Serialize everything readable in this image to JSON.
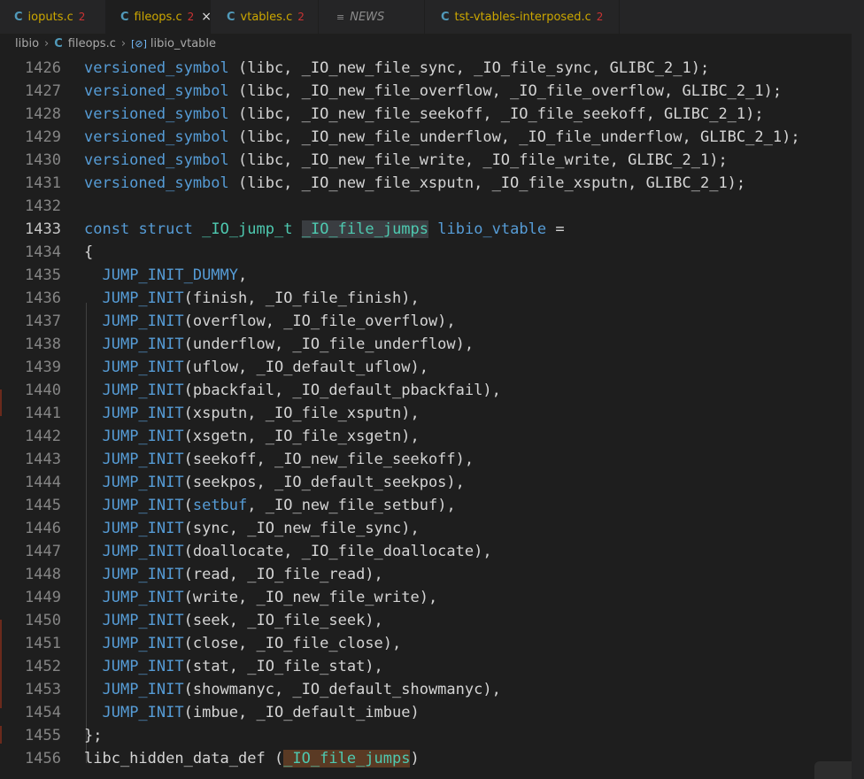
{
  "tabs": [
    {
      "label": "ioputs.c",
      "count": "2",
      "icon": "c-file-icon",
      "active": false
    },
    {
      "label": "fileops.c",
      "count": "2",
      "icon": "c-file-icon",
      "active": true
    },
    {
      "label": "vtables.c",
      "count": "2",
      "icon": "c-file-icon",
      "active": false
    },
    {
      "label": "NEWS",
      "count": "",
      "icon": "list-icon",
      "active": false
    },
    {
      "label": "tst-vtables-interposed.c",
      "count": "2",
      "icon": "c-file-icon",
      "active": false
    }
  ],
  "icons": {
    "c_file": "C",
    "close": "×",
    "news": "≡",
    "variable": "[⊘]"
  },
  "breadcrumb": {
    "folder": "libio",
    "file": "fileops.c",
    "symbol": "libio_vtable"
  },
  "colors": {
    "keyword": "#569cd6",
    "type": "#4ec9b0",
    "macro": "#569cd6",
    "plain": "#d4d4d4",
    "highlight_read": "#3a3d41",
    "highlight_write": "#5a3a24"
  },
  "lines": [
    {
      "num": "1426",
      "parts": [
        {
          "t": "versioned_symbol",
          "c": "k"
        },
        {
          "t": " (libc, _IO_new_file_sync, _IO_file_sync, GLIBC_2_1);",
          "c": "p"
        }
      ]
    },
    {
      "num": "1427",
      "parts": [
        {
          "t": "versioned_symbol",
          "c": "k"
        },
        {
          "t": " (libc, _IO_new_file_overflow, _IO_file_overflow, GLIBC_2_1);",
          "c": "p"
        }
      ]
    },
    {
      "num": "1428",
      "parts": [
        {
          "t": "versioned_symbol",
          "c": "k"
        },
        {
          "t": " (libc, _IO_new_file_seekoff, _IO_file_seekoff, GLIBC_2_1);",
          "c": "p"
        }
      ]
    },
    {
      "num": "1429",
      "parts": [
        {
          "t": "versioned_symbol",
          "c": "k"
        },
        {
          "t": " (libc, _IO_new_file_underflow, _IO_file_underflow, GLIBC_2_1);",
          "c": "p"
        }
      ]
    },
    {
      "num": "1430",
      "parts": [
        {
          "t": "versioned_symbol",
          "c": "k"
        },
        {
          "t": " (libc, _IO_new_file_write, _IO_file_write, GLIBC_2_1);",
          "c": "p"
        }
      ]
    },
    {
      "num": "1431",
      "parts": [
        {
          "t": "versioned_symbol",
          "c": "k"
        },
        {
          "t": " (libc, _IO_new_file_xsputn, _IO_file_xsputn, GLIBC_2_1);",
          "c": "p"
        }
      ]
    },
    {
      "num": "1432",
      "parts": []
    },
    {
      "num": "1433",
      "current": true,
      "parts": [
        {
          "t": "const",
          "c": "k"
        },
        {
          "t": " ",
          "c": "p"
        },
        {
          "t": "struct",
          "c": "k"
        },
        {
          "t": " ",
          "c": "p"
        },
        {
          "t": "_IO_jump_t",
          "c": "t"
        },
        {
          "t": " ",
          "c": "p"
        },
        {
          "t": "_IO_file_jumps",
          "c": "hl"
        },
        {
          "t": " ",
          "c": "p"
        },
        {
          "t": "libio_vtable",
          "c": "k"
        },
        {
          "t": " =",
          "c": "p"
        }
      ]
    },
    {
      "num": "1434",
      "parts": [
        {
          "t": "{",
          "c": "p"
        }
      ]
    },
    {
      "num": "1435",
      "parts": [
        {
          "t": "  ",
          "c": "p"
        },
        {
          "t": "JUMP_INIT_DUMMY",
          "c": "k"
        },
        {
          "t": ",",
          "c": "p"
        }
      ]
    },
    {
      "num": "1436",
      "parts": [
        {
          "t": "  ",
          "c": "p"
        },
        {
          "t": "JUMP_INIT",
          "c": "k"
        },
        {
          "t": "(finish, _IO_file_finish),",
          "c": "p"
        }
      ]
    },
    {
      "num": "1437",
      "parts": [
        {
          "t": "  ",
          "c": "p"
        },
        {
          "t": "JUMP_INIT",
          "c": "k"
        },
        {
          "t": "(overflow, _IO_file_overflow),",
          "c": "p"
        }
      ]
    },
    {
      "num": "1438",
      "parts": [
        {
          "t": "  ",
          "c": "p"
        },
        {
          "t": "JUMP_INIT",
          "c": "k"
        },
        {
          "t": "(underflow, _IO_file_underflow),",
          "c": "p"
        }
      ]
    },
    {
      "num": "1439",
      "parts": [
        {
          "t": "  ",
          "c": "p"
        },
        {
          "t": "JUMP_INIT",
          "c": "k"
        },
        {
          "t": "(uflow, _IO_default_uflow),",
          "c": "p"
        }
      ]
    },
    {
      "num": "1440",
      "parts": [
        {
          "t": "  ",
          "c": "p"
        },
        {
          "t": "JUMP_INIT",
          "c": "k"
        },
        {
          "t": "(pbackfail, _IO_default_pbackfail),",
          "c": "p"
        }
      ]
    },
    {
      "num": "1441",
      "parts": [
        {
          "t": "  ",
          "c": "p"
        },
        {
          "t": "JUMP_INIT",
          "c": "k"
        },
        {
          "t": "(xsputn, _IO_file_xsputn),",
          "c": "p"
        }
      ]
    },
    {
      "num": "1442",
      "parts": [
        {
          "t": "  ",
          "c": "p"
        },
        {
          "t": "JUMP_INIT",
          "c": "k"
        },
        {
          "t": "(xsgetn, _IO_file_xsgetn),",
          "c": "p"
        }
      ]
    },
    {
      "num": "1443",
      "parts": [
        {
          "t": "  ",
          "c": "p"
        },
        {
          "t": "JUMP_INIT",
          "c": "k"
        },
        {
          "t": "(seekoff, _IO_new_file_seekoff),",
          "c": "p"
        }
      ]
    },
    {
      "num": "1444",
      "parts": [
        {
          "t": "  ",
          "c": "p"
        },
        {
          "t": "JUMP_INIT",
          "c": "k"
        },
        {
          "t": "(seekpos, _IO_default_seekpos),",
          "c": "p"
        }
      ]
    },
    {
      "num": "1445",
      "parts": [
        {
          "t": "  ",
          "c": "p"
        },
        {
          "t": "JUMP_INIT",
          "c": "k"
        },
        {
          "t": "(",
          "c": "p"
        },
        {
          "t": "setbuf",
          "c": "k"
        },
        {
          "t": ", _IO_new_file_setbuf),",
          "c": "p"
        }
      ]
    },
    {
      "num": "1446",
      "parts": [
        {
          "t": "  ",
          "c": "p"
        },
        {
          "t": "JUMP_INIT",
          "c": "k"
        },
        {
          "t": "(sync, _IO_new_file_sync),",
          "c": "p"
        }
      ]
    },
    {
      "num": "1447",
      "parts": [
        {
          "t": "  ",
          "c": "p"
        },
        {
          "t": "JUMP_INIT",
          "c": "k"
        },
        {
          "t": "(doallocate, _IO_file_doallocate),",
          "c": "p"
        }
      ]
    },
    {
      "num": "1448",
      "parts": [
        {
          "t": "  ",
          "c": "p"
        },
        {
          "t": "JUMP_INIT",
          "c": "k"
        },
        {
          "t": "(read, _IO_file_read),",
          "c": "p"
        }
      ]
    },
    {
      "num": "1449",
      "parts": [
        {
          "t": "  ",
          "c": "p"
        },
        {
          "t": "JUMP_INIT",
          "c": "k"
        },
        {
          "t": "(write, _IO_new_file_write),",
          "c": "p"
        }
      ]
    },
    {
      "num": "1450",
      "parts": [
        {
          "t": "  ",
          "c": "p"
        },
        {
          "t": "JUMP_INIT",
          "c": "k"
        },
        {
          "t": "(seek, _IO_file_seek),",
          "c": "p"
        }
      ]
    },
    {
      "num": "1451",
      "parts": [
        {
          "t": "  ",
          "c": "p"
        },
        {
          "t": "JUMP_INIT",
          "c": "k"
        },
        {
          "t": "(close, _IO_file_close),",
          "c": "p"
        }
      ]
    },
    {
      "num": "1452",
      "parts": [
        {
          "t": "  ",
          "c": "p"
        },
        {
          "t": "JUMP_INIT",
          "c": "k"
        },
        {
          "t": "(stat, _IO_file_stat),",
          "c": "p"
        }
      ]
    },
    {
      "num": "1453",
      "parts": [
        {
          "t": "  ",
          "c": "p"
        },
        {
          "t": "JUMP_INIT",
          "c": "k"
        },
        {
          "t": "(showmanyc, _IO_default_showmanyc),",
          "c": "p"
        }
      ]
    },
    {
      "num": "1454",
      "parts": [
        {
          "t": "  ",
          "c": "p"
        },
        {
          "t": "JUMP_INIT",
          "c": "k"
        },
        {
          "t": "(imbue, _IO_default_imbue)",
          "c": "p"
        }
      ]
    },
    {
      "num": "1455",
      "parts": [
        {
          "t": "};",
          "c": "p"
        }
      ]
    },
    {
      "num": "1456",
      "parts": [
        {
          "t": "libc_hidden_data_def",
          "c": "n"
        },
        {
          "t": " (",
          "c": "p"
        },
        {
          "t": "_IO_file_jumps",
          "c": "hw"
        },
        {
          "t": ")",
          "c": "p"
        }
      ]
    }
  ]
}
